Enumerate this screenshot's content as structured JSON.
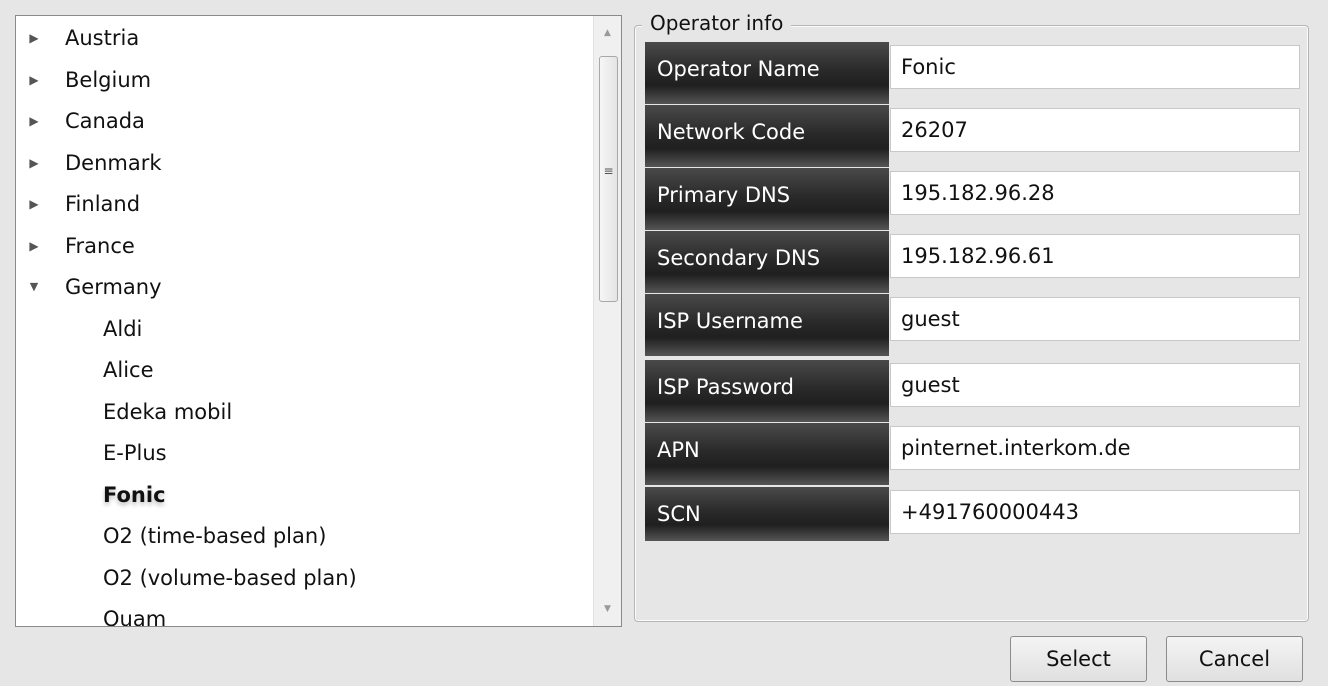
{
  "tree": {
    "rows": [
      {
        "label": "Austria",
        "expander": "collapsed",
        "level": 0
      },
      {
        "label": "Belgium",
        "expander": "collapsed",
        "level": 0
      },
      {
        "label": "Canada",
        "expander": "collapsed",
        "level": 0
      },
      {
        "label": "Denmark",
        "expander": "collapsed",
        "level": 0
      },
      {
        "label": "Finland",
        "expander": "collapsed",
        "level": 0
      },
      {
        "label": "France",
        "expander": "collapsed",
        "level": 0
      },
      {
        "label": "Germany",
        "expander": "expanded",
        "level": 0
      },
      {
        "label": "Aldi",
        "level": 1
      },
      {
        "label": "Alice",
        "level": 1
      },
      {
        "label": "Edeka mobil",
        "level": 1
      },
      {
        "label": "E-Plus",
        "level": 1
      },
      {
        "label": "Fonic",
        "level": 1,
        "selected": true
      },
      {
        "label": "O2 (time-based plan)",
        "level": 1
      },
      {
        "label": "O2 (volume-based plan)",
        "level": 1
      },
      {
        "label": "Quam",
        "level": 1
      }
    ],
    "expander_icons": {
      "collapsed": "▶",
      "expanded": "▼"
    }
  },
  "scrollbar": {
    "up_icon": "▲",
    "down_icon": "▼",
    "grip_icon": "≡"
  },
  "operator_info": {
    "title": "Operator info",
    "fields": [
      {
        "label": "Operator Name",
        "value": "Fonic"
      },
      {
        "label": "Network Code",
        "value": "26207"
      },
      {
        "label": "Primary DNS",
        "value": "195.182.96.28"
      },
      {
        "label": "Secondary DNS",
        "value": "195.182.96.61"
      },
      {
        "label": "ISP Username",
        "value": "guest"
      },
      {
        "label": "ISP Password",
        "value": "guest"
      },
      {
        "label": "APN",
        "value": "pinternet.interkom.de"
      },
      {
        "label": "SCN",
        "value": "+491760000443"
      }
    ]
  },
  "buttons": {
    "select": "Select",
    "cancel": "Cancel"
  }
}
